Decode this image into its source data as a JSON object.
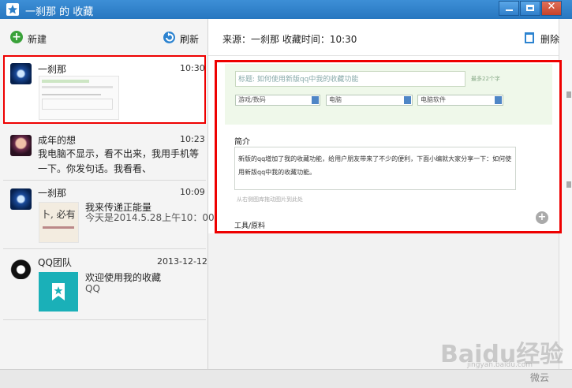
{
  "window": {
    "title": "一刹那 的 收藏"
  },
  "toolbar": {
    "new_label": "新建",
    "refresh_label": "刷新",
    "delete_label": "删除"
  },
  "items": [
    {
      "name": "一刹那",
      "time": "10:30",
      "lines": []
    },
    {
      "name": "成年的想",
      "time": "10:23",
      "lines": [
        "我电脑不显示，看不出来，我用手机等",
        "一下。你发句话。我看看、"
      ]
    },
    {
      "name": "一刹那",
      "time": "10:09",
      "lines": [
        "我来传递正能量",
        "今天是2014.5.28上午10：00"
      ],
      "thumb_text": "卜, 必有"
    },
    {
      "name": "QQ团队",
      "time": "2013-12-12",
      "lines": [
        "欢迎使用我的收藏",
        "QQ"
      ]
    }
  ],
  "detail": {
    "source_line": "来源：一刹那    收藏时间：10:30",
    "title_field": "标题:  如何使用新版qq中我的收藏功能",
    "title_limit": "最多22个字",
    "selects": [
      "游戏/数码",
      "电脑",
      "电脑软件"
    ],
    "intro_label": "简介",
    "intro_text": "新版的qq增加了我的收藏功能，给用户朋友带来了不少的便利，下面小编就大家分享一下：如何使用新版qq中我的收藏功能。",
    "insert_hint": "从右侧图库拖动图片到此处",
    "tools_label": "工具/原料"
  },
  "watermark": {
    "brand": "Baidu经验",
    "url": "jingyan.baidu.com",
    "app": "微云"
  },
  "colors": {
    "titlebar": "#2d7fc8",
    "highlight": "#e00000",
    "form_bg": "#eff8ea"
  }
}
